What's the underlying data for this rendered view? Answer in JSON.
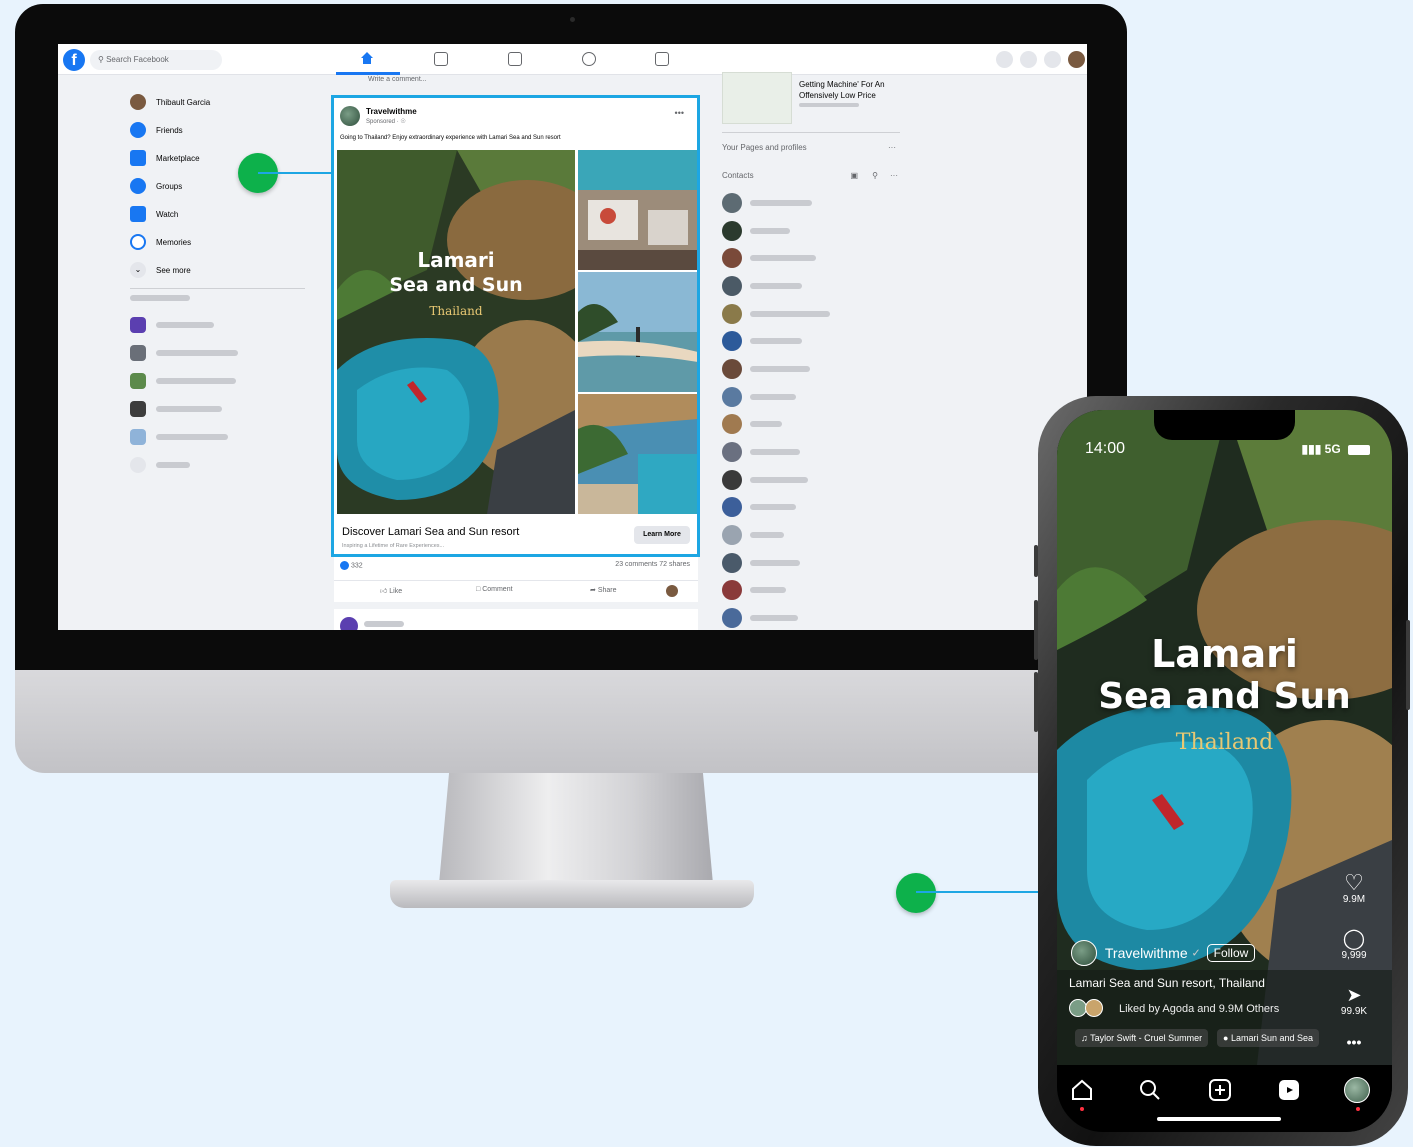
{
  "facebook": {
    "search_placeholder": "Search Facebook",
    "comment_placeholder": "Write a comment...",
    "sidebar": {
      "user_name": "Thibault Garcia",
      "items": [
        {
          "label": "Friends",
          "icon": "friends-icon",
          "color": "#1877f2"
        },
        {
          "label": "Marketplace",
          "icon": "marketplace-icon",
          "color": "#1877f2"
        },
        {
          "label": "Groups",
          "icon": "groups-icon",
          "color": "#1877f2"
        },
        {
          "label": "Watch",
          "icon": "watch-icon",
          "color": "#1877f2"
        },
        {
          "label": "Memories",
          "icon": "memories-icon",
          "color": "#1877f2"
        },
        {
          "label": "See more",
          "icon": "chevron-down-icon",
          "color": "#e4e6eb"
        }
      ]
    },
    "post": {
      "author": "Travelwithme",
      "sponsored": "Sponsored · ",
      "text": "Going to Thailand? Enjoy extraordinary experience with Lamari Sea and Sun resort",
      "image_title_line1": "Lamari",
      "image_title_line2": "Sea and Sun",
      "image_subtitle": "Thailand",
      "cta_title": "Discover Lamari Sea and Sun resort",
      "cta_subtitle": "Inspiring a Lifetime of Rare Experiences...",
      "cta_button": "Learn More",
      "reactions": "332",
      "comments_shares": "23 comments  72 shares",
      "like": "Like",
      "comment": "Comment",
      "share": "Share"
    },
    "right": {
      "ad_title_line1": "Getting Machine' For An",
      "ad_title_line2": "Offensively Low Price",
      "pages_header": "Your Pages and profiles",
      "contacts_header": "Contacts"
    }
  },
  "reels": {
    "time": "14:00",
    "network": "5G",
    "title_line1": "Lamari",
    "title_line2": "Sea and Sun",
    "subtitle": "Thailand",
    "username": "Travelwithme",
    "follow": "Follow",
    "caption": "Lamari Sea and Sun resort, Thailand",
    "liked_by": "Liked by Agoda and 9.9M Others",
    "audio": "Taylor Swift - Cruel Summer",
    "tag": "Lamari Sun and Sea",
    "likes": "9.9M",
    "comments": "9,999",
    "shares": "99.9K"
  },
  "colors": {
    "facebook_blue": "#1877f2",
    "highlight": "#1da6e3",
    "connector_dot": "#0db14b",
    "background": "#e8f3fd"
  }
}
